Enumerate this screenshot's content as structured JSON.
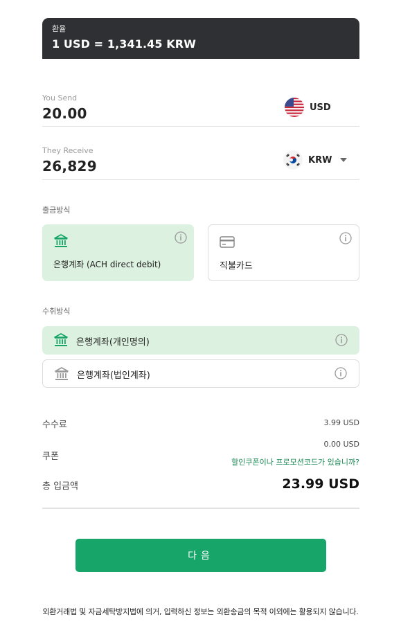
{
  "rate": {
    "label": "환율",
    "value": "1 USD = 1,341.45 KRW"
  },
  "send": {
    "label": "You Send",
    "amount": "20.00",
    "currency": "USD",
    "flag": "us-flag-icon"
  },
  "receive": {
    "label": "They Receive",
    "amount": "26,829",
    "currency": "KRW",
    "flag": "kr-flag-icon"
  },
  "payment": {
    "title": "출금방식",
    "options": [
      {
        "label": "은행계좌 (ACH direct debit)",
        "icon": "bank-icon",
        "selected": true
      },
      {
        "label": "직불카드",
        "icon": "credit-card-icon",
        "selected": false
      }
    ]
  },
  "receive_method": {
    "title": "수취방식",
    "options": [
      {
        "label": "은행계좌(개인명의)",
        "icon": "bank-icon",
        "selected": true
      },
      {
        "label": "은행계좌(법인계좌)",
        "icon": "bank-icon",
        "selected": false
      }
    ]
  },
  "summary": {
    "fee_label": "수수료",
    "fee_value": "3.99 USD",
    "coupon_label": "쿠폰",
    "coupon_value": "0.00 USD",
    "coupon_link": "할인쿠폰이나 프로모션코드가 있습니까?",
    "total_label": "총 입금액",
    "total_value": "23.99 USD"
  },
  "next_button": "다음",
  "notice": "외환거래법 및 자금세탁방지법에 의거, 입력하신 정보는 외환송금의 목적 이외에는 활용되지 않습니다.",
  "colors": {
    "accent": "#17a56a",
    "selected_bg": "#dcf1df",
    "header_bg": "#2f3033",
    "link": "#1b8a55"
  }
}
